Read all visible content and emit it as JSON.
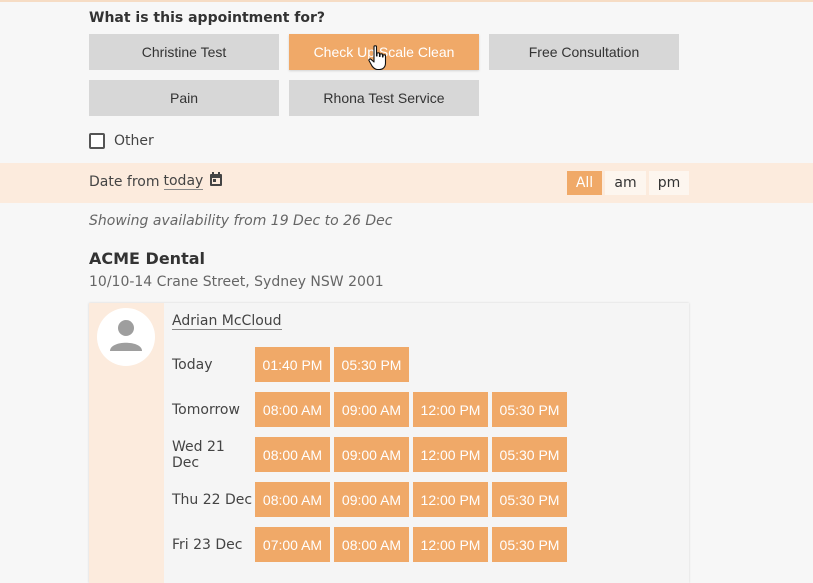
{
  "question": "What is this appointment for?",
  "services": [
    "Christine Test",
    "Check Up Scale Clean",
    "Free Consultation",
    "Pain",
    "Rhona Test Service"
  ],
  "other_label": "Other",
  "date_filter": {
    "prefix": "Date from",
    "value": "today"
  },
  "time_filters": [
    "All",
    "am",
    "pm"
  ],
  "showing": "Showing availability from 19 Dec to 26 Dec",
  "clinic": {
    "name": "ACME Dental",
    "address": "10/10-14 Crane Street, Sydney NSW 2001"
  },
  "practitioner": "Adrian McCloud",
  "days": [
    {
      "label": "Today",
      "slots": [
        "01:40 PM",
        "05:30 PM"
      ]
    },
    {
      "label": "Tomorrow",
      "slots": [
        "08:00 AM",
        "09:00 AM",
        "12:00 PM",
        "05:30 PM"
      ]
    },
    {
      "label": "Wed 21 Dec",
      "slots": [
        "08:00 AM",
        "09:00 AM",
        "12:00 PM",
        "05:30 PM"
      ]
    },
    {
      "label": "Thu 22 Dec",
      "slots": [
        "08:00 AM",
        "09:00 AM",
        "12:00 PM",
        "05:30 PM"
      ]
    },
    {
      "label": "Fri 23 Dec",
      "slots": [
        "07:00 AM",
        "08:00 AM",
        "12:00 PM",
        "05:30 PM"
      ]
    }
  ],
  "colors": {
    "accent": "#f0a968",
    "button_gray": "#d7d7d7",
    "highlight_bg": "#fcebdd"
  }
}
